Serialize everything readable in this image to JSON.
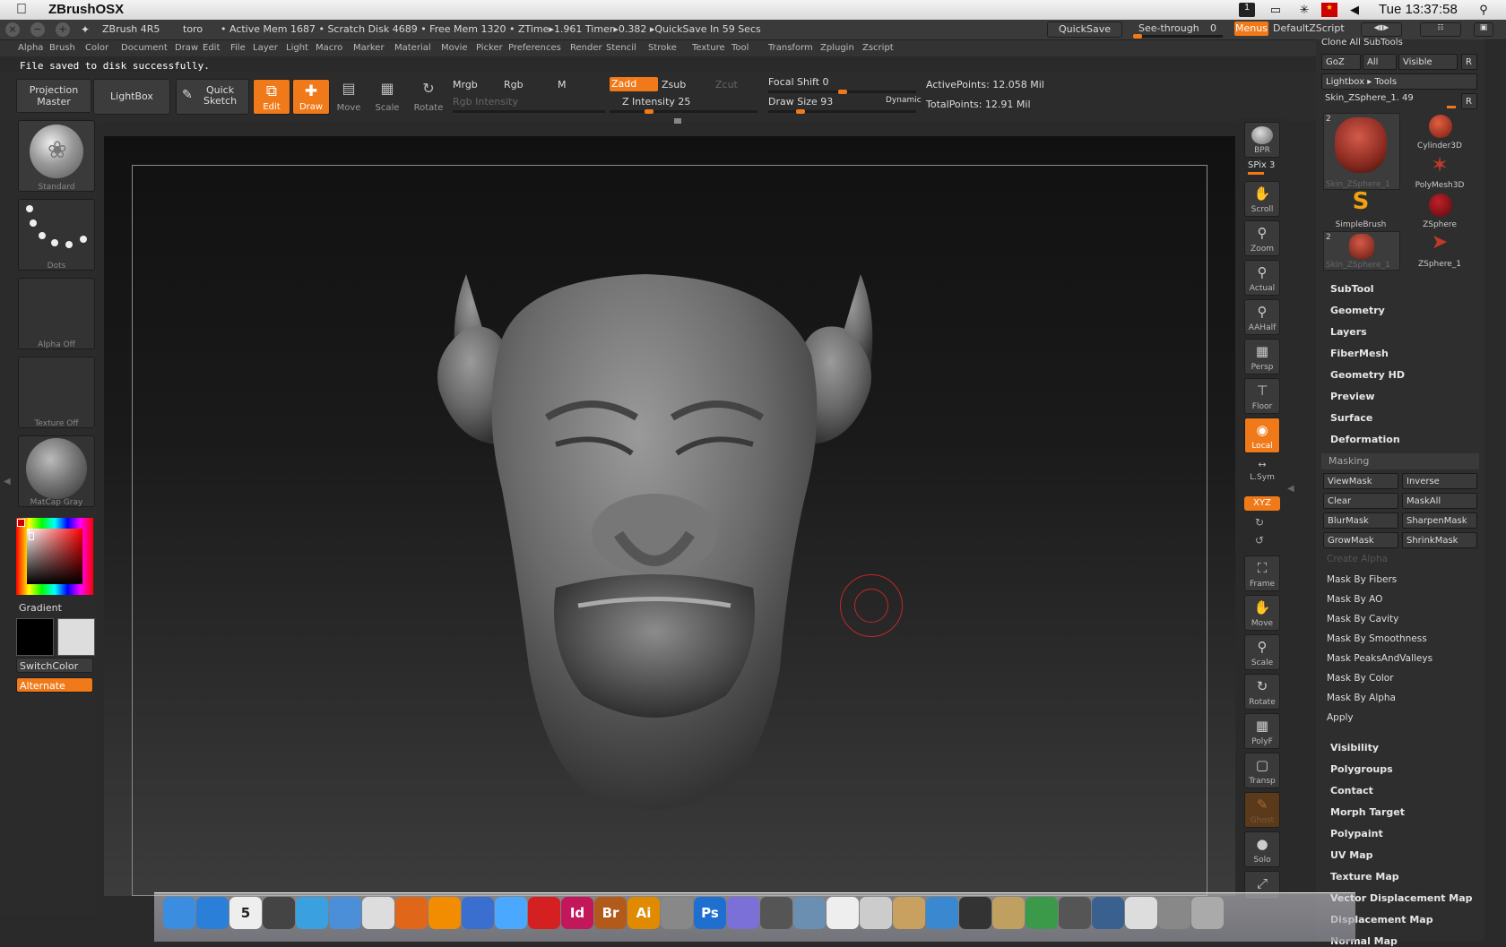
{
  "menubar": {
    "apple": "",
    "app_name": "ZBrushOSX",
    "clock": "Tue 13:37:58",
    "icons": [
      "tablet-icon",
      "display-icon",
      "bluetooth-icon",
      "flag-icon",
      "volume-icon",
      "spotlight-icon"
    ]
  },
  "title": {
    "version": "ZBrush 4R5",
    "doc": "toro",
    "stats": "• Active Mem 1687 • Scratch Disk 4689 • Free Mem 1320 • ZTime▸1.961 Timer▸0.382 ▸QuickSave In 59 Secs",
    "quicksave": "QuickSave",
    "see_through": "See-through",
    "see_through_val": "0",
    "menus": "Menus",
    "default_script": "DefaultZScript"
  },
  "menus": [
    "Alpha",
    "Brush",
    "Color",
    "Document",
    "Draw",
    "Edit",
    "File",
    "Layer",
    "Light",
    "Macro",
    "Marker",
    "Material",
    "Movie",
    "Picker",
    "Preferences",
    "Render",
    "Stencil",
    "Stroke",
    "Texture",
    "Tool",
    "Transform",
    "Zplugin",
    "Zscript"
  ],
  "status_message": "File saved to disk successfully.",
  "shelf": {
    "projection_master": "Projection\nMaster",
    "lightbox": "LightBox",
    "quick_sketch": "Quick\nSketch",
    "edit": "Edit",
    "draw": "Draw",
    "move": "Move",
    "scale": "Scale",
    "rotate": "Rotate",
    "mrgb": "Mrgb",
    "rgb": "Rgb",
    "m": "M",
    "zadd": "Zadd",
    "zsub": "Zsub",
    "zcut": "Zcut",
    "rgb_intensity": "Rgb Intensity",
    "z_intensity": "Z Intensity 25",
    "focal_shift": "Focal Shift 0",
    "draw_size": "Draw Size 93",
    "dynamic": "Dynamic",
    "active_points": "ActivePoints: 12.058 Mil",
    "total_points": "TotalPoints: 12.91 Mil",
    "z_intensity_level": 0.25,
    "focal_level": 0.5,
    "draw_size_level": 0.2
  },
  "left_tray": {
    "brush": "Standard",
    "stroke": "Dots",
    "alpha": "Alpha Off",
    "texture": "Texture Off",
    "material": "MatCap Gray",
    "gradient": "Gradient",
    "switch_color": "SwitchColor",
    "alternate": "Alternate"
  },
  "right_shelf": {
    "bpr": "BPR",
    "spix": "SPix 3",
    "scroll": "Scroll",
    "zoom": "Zoom",
    "actual": "Actual",
    "aahalf": "AAHalf",
    "persp": "Persp",
    "floor": "Floor",
    "local": "Local",
    "lsym": "L.Sym",
    "xyz": "XYZ",
    "frame": "Frame",
    "move": "Move",
    "scale": "Scale",
    "rotate": "Rotate",
    "polyf": "PolyF",
    "transp": "Transp",
    "ghost": "Ghost",
    "solo": "Solo"
  },
  "tool_palette": {
    "clone_all": "Clone All SubTools",
    "goz": "GoZ",
    "all": "All",
    "visible": "Visible",
    "r": "R",
    "lightbox_tools": "Lightbox ▸ Tools",
    "current_tool": "Skin_ZSphere_1. 49",
    "tools": [
      {
        "name": "Skin_ZSphere_1",
        "count": "2"
      },
      {
        "name": "Cylinder3D",
        "count": ""
      },
      {
        "name": "PolyMesh3D",
        "count": ""
      },
      {
        "name": "SimpleBrush",
        "count": ""
      },
      {
        "name": "ZSphere",
        "count": ""
      },
      {
        "name": "Skin_ZSphere_1",
        "count": "2"
      },
      {
        "name": "ZSphere_1",
        "count": ""
      }
    ],
    "sections_top": [
      "SubTool",
      "Geometry",
      "Layers",
      "FiberMesh",
      "Geometry HD",
      "Preview",
      "Surface",
      "Deformation"
    ],
    "masking": "Masking",
    "mask_buttons": [
      "ViewMask",
      "Inverse",
      "Clear",
      "MaskAll",
      "BlurMask",
      "SharpenMask",
      "GrowMask",
      "ShrinkMask"
    ],
    "create_alpha": "Create Alpha",
    "mask_items": [
      "Mask By Fibers",
      "Mask By AO",
      "Mask By Cavity",
      "Mask By Smoothness",
      "Mask PeaksAndValleys",
      "Mask By Color",
      "Mask By Alpha",
      "Apply"
    ],
    "sections_bottom": [
      "Visibility",
      "Polygroups",
      "Contact",
      "Morph Target",
      "Polypaint",
      "UV Map",
      "Texture Map",
      "Vector Displacement Map",
      "Displacement Map",
      "Normal Map"
    ]
  },
  "dock": {
    "items": [
      "finder-icon",
      "app-store-icon",
      "calendar-icon",
      "dashboard-icon",
      "safari-icon",
      "facetime-icon",
      "dvd-icon",
      "firefox-icon",
      "vlc-icon",
      "quicktime-icon",
      "itunes-icon",
      "acrobat-icon",
      "indesign-icon",
      "bridge-icon",
      "illustrator-icon",
      "zbrush-icon",
      "photoshop-icon",
      "bbedit-icon",
      "app-icon",
      "preview-icon",
      "textedit-icon",
      "script-icon",
      "package-icon",
      "installer-icon",
      "x11-icon",
      "archive-icon",
      "monitor-icon",
      "time-machine-icon",
      "photos-icon",
      "documents-icon",
      "stack-icon",
      "trash-icon"
    ],
    "calendar_day": "5",
    "labels": {
      "Id": "Id",
      "Br": "Br",
      "Ai": "Ai",
      "Ps": "Ps"
    }
  },
  "colors": {
    "accent": "#f07a1a",
    "panel": "#2e2e2e",
    "canvas": "#1a1a1a"
  }
}
